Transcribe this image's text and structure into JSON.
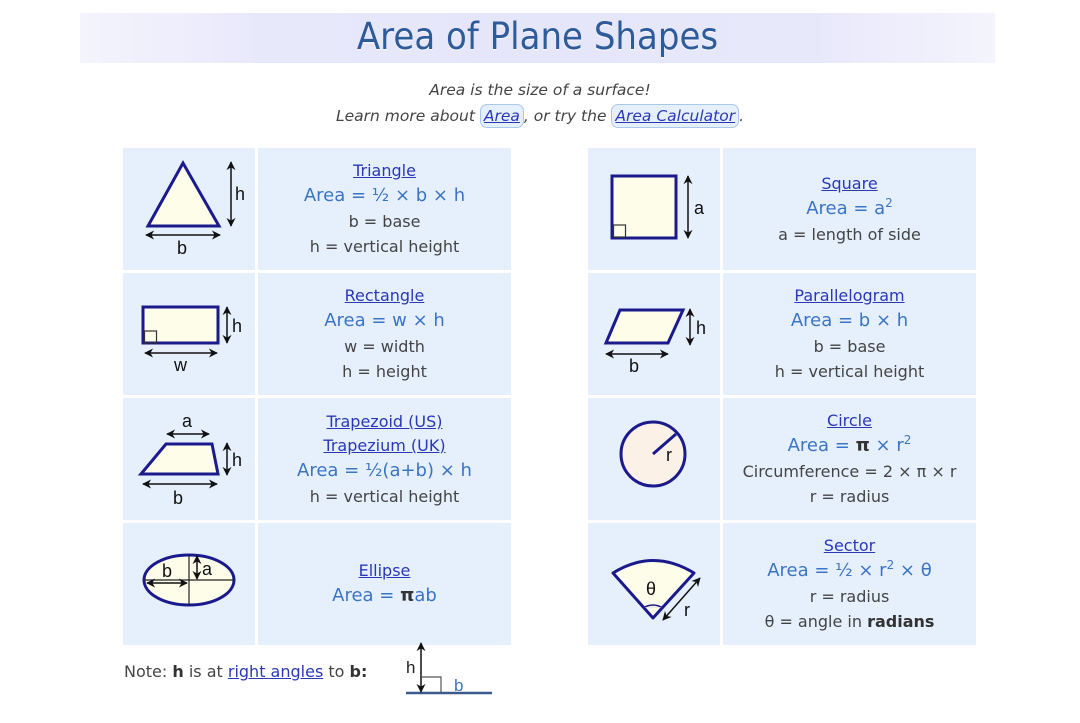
{
  "header": {
    "title": "Area of Plane Shapes"
  },
  "intro": {
    "line1": "Area is the size of a surface!",
    "line2_prefix": "Learn more about ",
    "area_link": "Area",
    "line2_middle": ", or try the ",
    "calculator_link": "Area Calculator",
    "line2_suffix": "."
  },
  "shapes": {
    "triangle": {
      "name": "Triangle",
      "formula": "Area = ½ × b × h",
      "desc": [
        "b = base",
        "h = vertical height"
      ],
      "labels": {
        "b": "b",
        "h": "h"
      }
    },
    "square": {
      "name": "Square",
      "formula_base": "Area = a",
      "formula_exp": "2",
      "desc": [
        "a = length of side"
      ],
      "labels": {
        "a": "a"
      }
    },
    "rectangle": {
      "name": "Rectangle",
      "formula": "Area = w × h",
      "desc": [
        "w = width",
        "h = height"
      ],
      "labels": {
        "w": "w",
        "h": "h"
      }
    },
    "parallelogram": {
      "name": "Parallelogram",
      "formula": "Area = b × h",
      "desc": [
        "b = base",
        "h = vertical height"
      ],
      "labels": {
        "b": "b",
        "h": "h"
      }
    },
    "trapezoid": {
      "name_us": "Trapezoid (US)",
      "name_uk": "Trapezium (UK)",
      "formula": "Area = ½(a+b) × h",
      "desc": [
        "h = vertical height"
      ],
      "labels": {
        "a": "a",
        "b": "b",
        "h": "h"
      }
    },
    "circle": {
      "name": "Circle",
      "formula_prefix": "Area = ",
      "formula_pi": "π",
      "formula_mid": " × r",
      "formula_exp": "2",
      "desc": [
        "Circumference = 2 × π × r",
        "r = radius"
      ],
      "labels": {
        "r": "r"
      }
    },
    "ellipse": {
      "name": "Ellipse",
      "formula_prefix": "Area = ",
      "formula_pi": "π",
      "formula_suffix": "ab",
      "labels": {
        "a": "a",
        "b": "b"
      }
    },
    "sector": {
      "name": "Sector",
      "formula_base": "Area = ½ × r",
      "formula_exp": "2",
      "formula_suffix": " × θ",
      "desc": [
        "r = radius"
      ],
      "desc2_prefix": "θ = angle in ",
      "desc2_bold": "radians",
      "labels": {
        "theta": "θ",
        "r": "r"
      }
    }
  },
  "note": {
    "prefix": "Note: ",
    "h": "h",
    "middle": " is at ",
    "link": "right angles",
    "to": " to ",
    "b": "b:",
    "diagram_h": "h",
    "diagram_b": "b"
  },
  "colors": {
    "title": "#2e5b9a",
    "link": "#2a38b8",
    "formula": "#3c74c4",
    "cell_bg": "#e6f0fc",
    "shape_stroke": "#1a1a8c",
    "shape_fill": "#fdfdea"
  }
}
